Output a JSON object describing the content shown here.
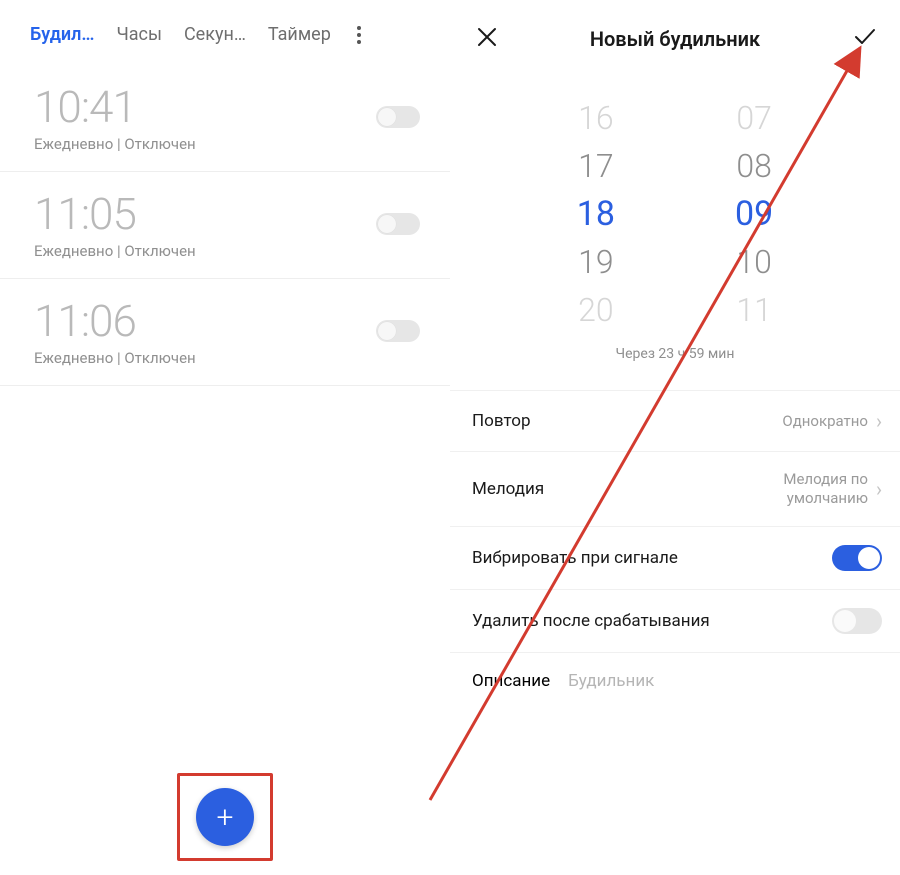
{
  "left": {
    "tabs": {
      "alarm": "Будил…",
      "clock": "Часы",
      "stopwatch": "Секун…",
      "timer": "Таймер"
    },
    "alarms": [
      {
        "time": "10:41",
        "sub": "Ежедневно  |  Отключен"
      },
      {
        "time": "11:05",
        "sub": "Ежедневно  |  Отключен"
      },
      {
        "time": "11:06",
        "sub": "Ежедневно  |  Отключен"
      }
    ],
    "fab_glyph": "+"
  },
  "right": {
    "title": "Новый будильник",
    "picker": {
      "hours": [
        "16",
        "17",
        "18",
        "19",
        "20"
      ],
      "minutes": [
        "07",
        "08",
        "09",
        "10",
        "11"
      ]
    },
    "eta": "Через 23 ч 59 мин",
    "rows": {
      "repeat_label": "Повтор",
      "repeat_value": "Однократно",
      "ringtone_label": "Мелодия",
      "ringtone_value": "Мелодия по умолчанию",
      "vibrate_label": "Вибрировать при сигнале",
      "delete_after_label": "Удалить после срабатывания",
      "description_label": "Описание",
      "description_placeholder": "Будильник"
    }
  }
}
